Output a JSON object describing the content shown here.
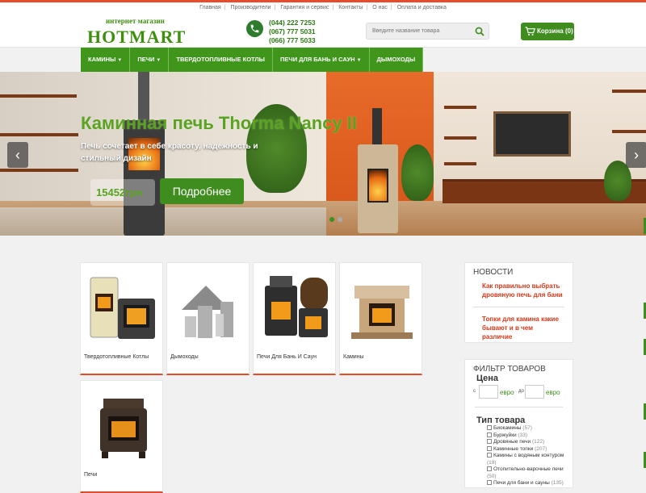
{
  "topnav": [
    "Главная",
    "Производители",
    "Гарантия и сервис",
    "Контакты",
    "О нас",
    "Оплата и доставка"
  ],
  "header": {
    "logo_sub": "интернет магазин",
    "logo": "HOTMART",
    "phones": [
      "(044) 222 7253",
      "(067) 777 5031",
      "(066) 777 5033"
    ],
    "search_placeholder": "Введите название товара",
    "cart_label": "Корзина (0)"
  },
  "nav": [
    {
      "label": "КАМИНЫ",
      "dropdown": true
    },
    {
      "label": "ПЕЧИ",
      "dropdown": true
    },
    {
      "label": "ТВЕРДОТОПЛИВНЫЕ КОТЛЫ",
      "dropdown": false
    },
    {
      "label": "ПЕЧИ ДЛЯ БАНЬ И САУН",
      "dropdown": true
    },
    {
      "label": "ДЫМОХОДЫ",
      "dropdown": false
    }
  ],
  "hero": {
    "title": "Каминная печь Thorma Nancy II",
    "desc": "Печь сочетает в себе красоту, надежность и стильный дизайн",
    "price": "15452грн",
    "button": "Подробнее",
    "slides_count": 2,
    "active_slide": 0
  },
  "categories": [
    {
      "label": "Твердотопливные Котлы",
      "icon": "boiler-icon"
    },
    {
      "label": "Дымоходы",
      "icon": "chimney-icon"
    },
    {
      "label": "Печи Для Бань И Саун",
      "icon": "sauna-stove-icon"
    },
    {
      "label": "Камины",
      "icon": "fireplace-icon"
    },
    {
      "label": "Печи",
      "icon": "stove-icon"
    }
  ],
  "news": {
    "title": "НОВОСТИ",
    "items": [
      "Как правильно выбрать дровяную печь для бани",
      "Топки для камина какие бывают и в чем различие"
    ]
  },
  "filter": {
    "title": "ФИЛЬТР ТОВАРОВ",
    "price_label": "Цена",
    "from": "с",
    "to": "до",
    "currency": "евро",
    "type_label": "Тип товара",
    "types": [
      {
        "name": "Биокамины",
        "count": "(57)"
      },
      {
        "name": "Буржуйки",
        "count": "(33)"
      },
      {
        "name": "Дровяные печи",
        "count": "(122)"
      },
      {
        "name": "Каминные топки",
        "count": "(207)"
      },
      {
        "name": "Камины с водяным контуром",
        "count": "(19)"
      },
      {
        "name": "Отопительно-варочные печи",
        "count": "(50)"
      },
      {
        "name": "Печи для бани и сауны",
        "count": "(135)"
      }
    ]
  },
  "colors": {
    "accent": "#3f8d1f",
    "top_border": "#e84c2b",
    "news_link": "#d6381a"
  }
}
